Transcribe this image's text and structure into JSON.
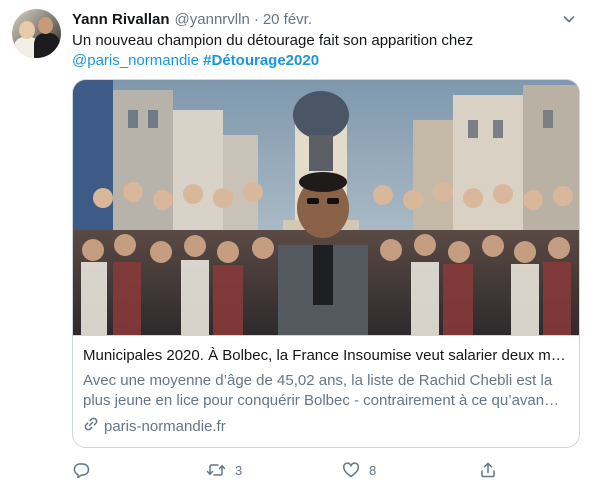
{
  "tweet": {
    "author_name": "Yann Rivallan",
    "author_handle": "@yannrvlln",
    "separator": "·",
    "date": "20 févr.",
    "text_line1": "Un nouveau champion du détourage fait son apparition chez",
    "mention": "@paris_normandie",
    "hashtag": "#Détourage2020"
  },
  "card": {
    "title": "Municipales 2020. À Bolbec, la France Insoumise veut salarier deux m…",
    "description_line1": "Avec une moyenne d’âge de 45,02 ans, la liste de Rachid Chebli est la",
    "description_line2": "plus jeune en lice pour conquérir Bolbec - contrairement à ce qu’avan…",
    "domain": "paris-normandie.fr"
  },
  "actions": {
    "reply_count": "",
    "retweet_count": "3",
    "like_count": "8"
  },
  "icons": [
    "chevron-down-icon",
    "reply-icon",
    "retweet-icon",
    "heart-icon",
    "share-icon",
    "link-icon"
  ],
  "colors": {
    "text_primary": "#14171a",
    "text_secondary": "#657786",
    "link": "#1b95e0",
    "border": "#ccd6dd"
  }
}
